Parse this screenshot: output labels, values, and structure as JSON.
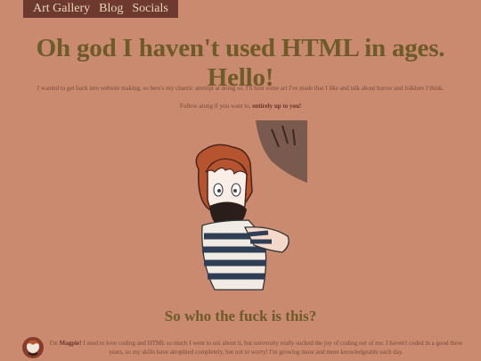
{
  "nav": {
    "items": [
      {
        "label": "Art Gallery"
      },
      {
        "label": "Blog"
      },
      {
        "label": "Socials"
      }
    ]
  },
  "header": {
    "title": "Oh god I haven't used HTML in ages. Hello!"
  },
  "intro": {
    "text": "I wanted to get back into website making, so here's my chaotic attempt at doing so. I'll host some art I've made that I like and talk about horror and folklore I think.",
    "follow_prefix": "Follow along if you want to, ",
    "follow_bold": "entirely up to you!"
  },
  "about": {
    "heading": "So who the fuck is this?",
    "prefix": "I'm ",
    "name": "Magpie!",
    "text": " I used to love coding and HTML so much I went to uni about it, but university really sucked the joy of coding out of me. I haven't coded in a good three years, so my skills have atrophied completely, but not to worry! I'm growing more and more knowledgeable each day."
  },
  "colors": {
    "background": "#c98a6f",
    "nav_bg": "#6e3a30",
    "heading": "#6f5a2a"
  },
  "icons": [
    "character-illustration",
    "avatar-sticker"
  ]
}
